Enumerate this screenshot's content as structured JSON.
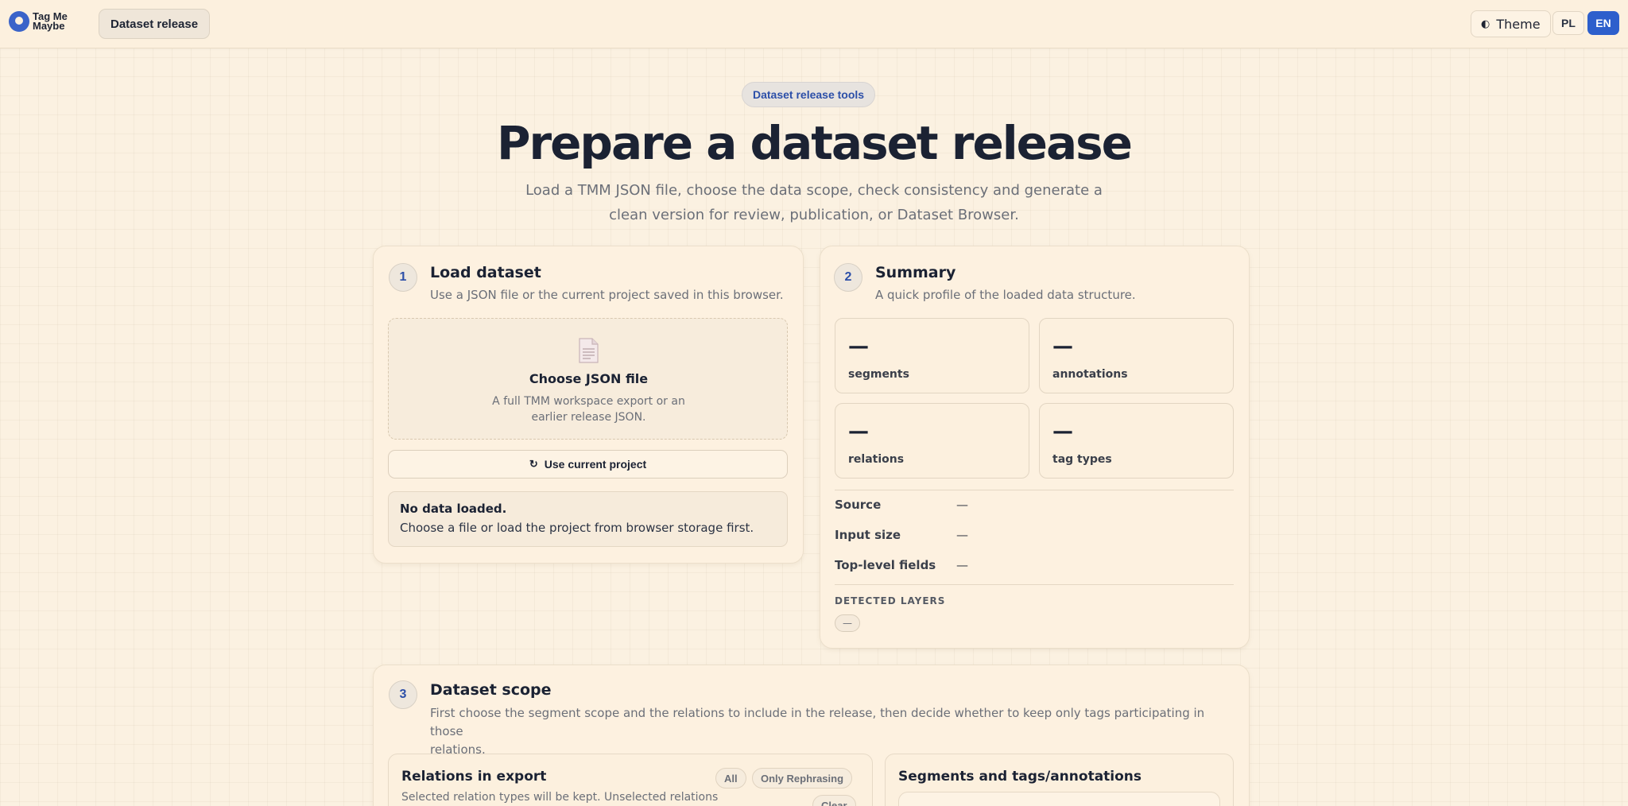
{
  "topbar": {
    "logo_line1": "Tag Me",
    "logo_line2": "Maybe",
    "nav_label": "Dataset release",
    "theme_label": "Theme",
    "lang_pl": "PL",
    "lang_en": "EN",
    "active_lang": "EN",
    "accent_color": "#2d5fcc"
  },
  "hero": {
    "pill": "Dataset release tools",
    "title": "Prepare a dataset release",
    "subtitle": "Load a TMM JSON file, choose the data scope, check consistency and generate a clean version for review, publication, or Dataset Browser."
  },
  "load": {
    "step": "1",
    "title": "Load dataset",
    "subtitle": "Use a JSON file or the current project saved in this browser.",
    "dropzone_title": "Choose JSON file",
    "dropzone_line1": "A full TMM workspace export or an",
    "dropzone_line2": "earlier release JSON.",
    "use_current_label": "Use current project",
    "status_title": "No data loaded.",
    "status_text": "Choose a file or load the project from browser storage first."
  },
  "summary": {
    "step": "2",
    "title": "Summary",
    "subtitle": "A quick profile of the loaded data structure.",
    "stats": [
      {
        "value": "—",
        "label": "segments"
      },
      {
        "value": "—",
        "label": "annotations"
      },
      {
        "value": "—",
        "label": "relations"
      },
      {
        "value": "—",
        "label": "tag types"
      }
    ],
    "fields": [
      {
        "key": "Source",
        "value": "—"
      },
      {
        "key": "Input size",
        "value": "—"
      },
      {
        "key": "Top-level fields",
        "value": "—"
      }
    ],
    "layers_label": "DETECTED LAYERS",
    "layers_value": "—"
  },
  "scope": {
    "step": "3",
    "title": "Dataset scope",
    "subtitle_line1": "First choose the segment scope and the relations to include in the release, then decide whether to keep only tags participating in those",
    "subtitle_line2": "relations.",
    "relations_title": "Relations in export",
    "relations_sub": "Selected relation types will be kept. Unselected relations",
    "btn_all": "All",
    "btn_only": "Only Rephrasing",
    "btn_clear": "Clear",
    "segments_title": "Segments and tags/annotations"
  }
}
